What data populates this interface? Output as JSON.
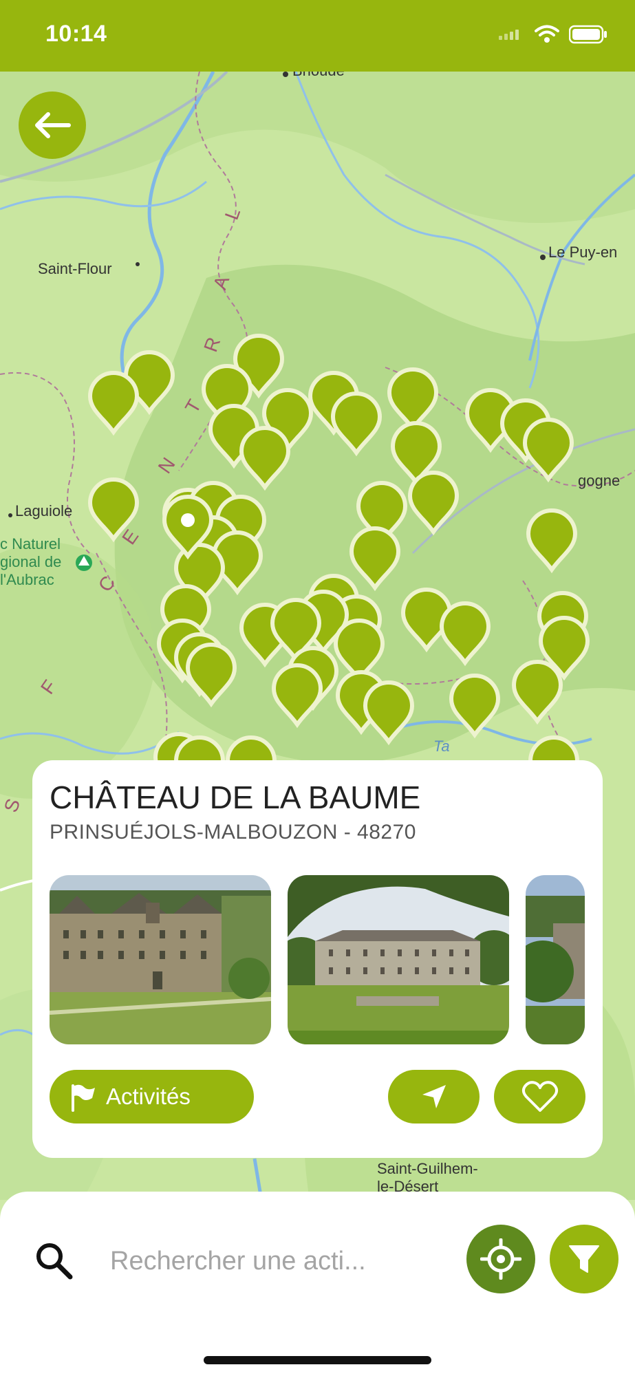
{
  "status_bar": {
    "time": "10:14"
  },
  "map": {
    "labels": {
      "brioude": "Brioude",
      "saint_flour": "Saint-Flour",
      "le_puy": "Le Puy-en",
      "laguiole": "Laguiole",
      "aubrac_1": "c Naturel",
      "aubrac_2": "gional de",
      "aubrac_3": "l'Aubrac",
      "bourgogne": "gogne",
      "saint_guilhem_1": "Saint-Guilhem-",
      "saint_guilhem_2": "le-Désert",
      "tarn": "Ta",
      "region_letters": [
        "L",
        "A",
        "R",
        "T",
        "N",
        "E",
        "C",
        "F",
        "S"
      ]
    },
    "pin_color": "#97b60e"
  },
  "card": {
    "title": "CHÂTEAU DE LA BAUME",
    "subtitle": "PRINSUÉJOLS-MALBOUZON - 48270",
    "activities_label": "Activités"
  },
  "search": {
    "placeholder": "Rechercher une acti..."
  },
  "colors": {
    "brand": "#97b60e",
    "locate_button": "#5f8a1e",
    "card_bg": "#ffffff"
  },
  "icons": [
    "back-arrow-icon",
    "flag-icon",
    "navigation-arrow-icon",
    "heart-icon",
    "search-icon",
    "locate-target-icon",
    "filter-funnel-icon"
  ]
}
